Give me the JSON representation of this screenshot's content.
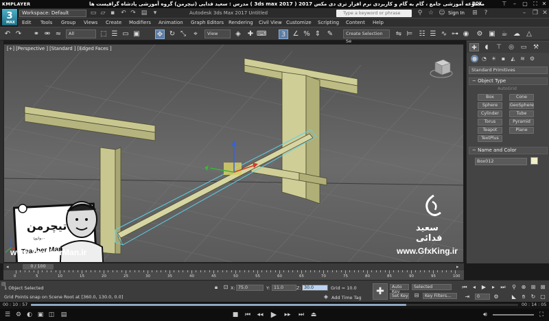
{
  "player": {
    "logo": "KMPLAYER",
    "title": "مجموعه آموزشی جامع ، گام به گام و کاربردی نرم افزار تری دی مکس 2017 ( 3ds max 2017 )  مدرس : سعید فدایی (تیچرمن) گروه آموزشی پادشاه گرافیست ها",
    "box_label": "BOX",
    "time_elapsed": "00 : 10 : 57",
    "time_total": "00 : 14 : 05",
    "progress_fraction": 0.77
  },
  "max": {
    "icon_label": "3",
    "icon_sub": "MAX",
    "workspace": "Workspace: Default",
    "app_title": "Autodesk 3ds Max 2017     Untitled",
    "search_placeholder": "Type a keyword or phrase",
    "signin": "Sign In",
    "menus": [
      "Edit",
      "Tools",
      "Group",
      "Views",
      "Create",
      "Modifiers",
      "Animation",
      "Graph Editors",
      "Rendering",
      "Civil View",
      "Customize",
      "Scripting",
      "Content",
      "Help"
    ]
  },
  "toolbar": {
    "filter_all": "All",
    "ref_coord": "View",
    "selection_set": "Create Selection Se"
  },
  "viewport": {
    "label": "[+] [Perspective ] [Standard ] [Edged Faces ]"
  },
  "cmdpanel": {
    "primitive_type": "Standard Primitives",
    "object_type_header": "Object Type",
    "autogrid": "AutoGrid",
    "buttons": [
      "Box",
      "Cone",
      "Sphere",
      "GeoSphere",
      "Cylinder",
      "Tube",
      "Torus",
      "Pyramid",
      "Teapot",
      "Plane",
      "TextPlus"
    ],
    "name_color_header": "Name and Color",
    "object_name": "Box012",
    "object_color": "#f0efc8"
  },
  "timeline": {
    "frame_indicator": "0 / 100",
    "ticks": [
      "0",
      "5",
      "10",
      "15",
      "20",
      "25",
      "30",
      "35",
      "40",
      "45",
      "50",
      "55",
      "60",
      "65",
      "70",
      "75",
      "80",
      "85",
      "90",
      "95",
      "100"
    ]
  },
  "status": {
    "selected": "1 Object Selected",
    "prompt": "Grid Points snap on Scene Root at [360.0, 130.0, 0.0]",
    "x_label": "X:",
    "x_value": "75.0",
    "y_label": "Y:",
    "y_value": "11.0",
    "z_label": "Z:",
    "z_value": "30.0",
    "grid": "Grid = 10.0",
    "add_time_tag": "Add Time Tag",
    "auto_key": "Auto Key",
    "set_key": "Set Key",
    "selected_dd": "Selected",
    "key_filters": "Key Filters...",
    "current_frame": "0"
  },
  "watermarks": {
    "teacherman_url": "www.TeacherMan.ir",
    "teacherman_brand": "Teacher Man",
    "teacherman_persian": "تیچرمن",
    "teacherman_tagline": "وانجا...",
    "gfx_name": "سعید فدائی",
    "gfx_url": "www.GfxKing.ir"
  }
}
